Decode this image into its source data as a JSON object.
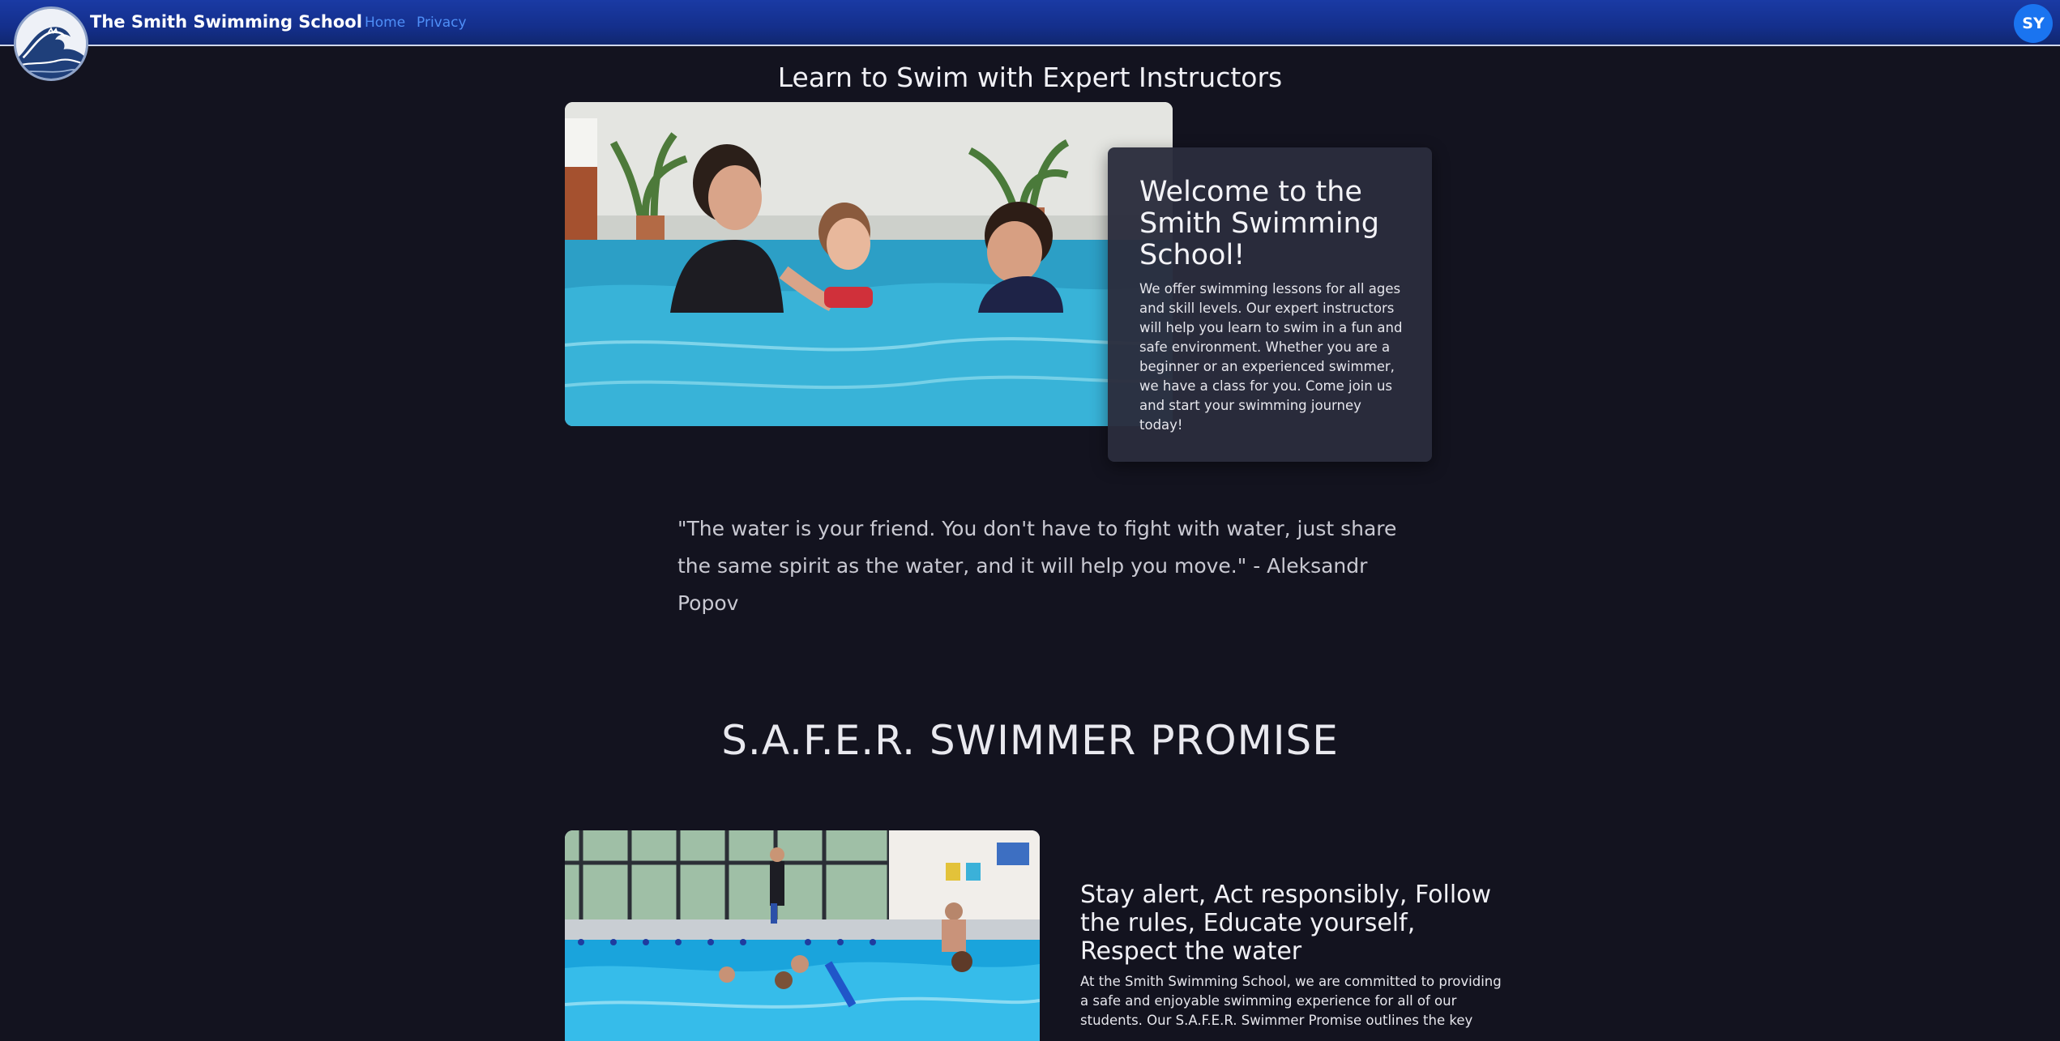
{
  "navbar": {
    "brand": "The Smith Swimming School",
    "links": [
      "Home",
      "Privacy"
    ],
    "avatar_initials": "SY"
  },
  "hero": {
    "title": "Learn to Swim with Expert Instructors",
    "card_title": "Welcome to the Smith Swimming School!",
    "card_text": "We offer swimming lessons for all ages and skill levels. Our expert instructors will help you learn to swim in a fun and safe environment. Whether you are a beginner or an experienced swimmer, we have a class for you. Come join us and start your swimming journey today!"
  },
  "quote": {
    "text": "\"The water is your friend. You don't have to fight with water, just share the same spirit as the water, and it will help you move.\" - Aleksandr Popov"
  },
  "promise": {
    "title": "S.A.F.E.R. SWIMMER PROMISE",
    "heading": "Stay alert, Act responsibly, Follow the rules, Educate yourself, Respect the water",
    "text": "At the Smith Swimming School, we are committed to providing a safe and enjoyable swimming experience for all of our students. Our S.A.F.E.R. Swimmer Promise outlines the key"
  },
  "colors": {
    "background": "#13131f",
    "navbar": "#142f8c",
    "link": "#4f8ff7",
    "avatar": "#1a74f0",
    "card": "#2b2d3c"
  },
  "icons": {
    "logo": "great-wave-logo",
    "avatar": "user-avatar-icon"
  }
}
